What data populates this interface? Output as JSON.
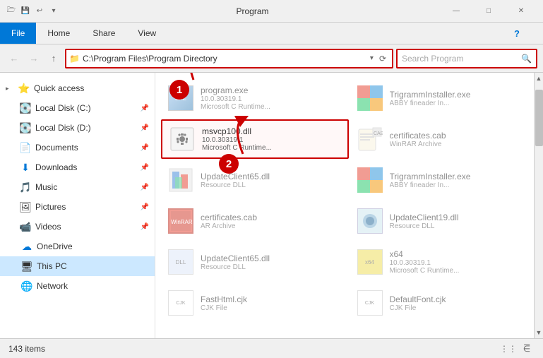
{
  "titleBar": {
    "title": "Program",
    "icons": [
      "folder-small",
      "save",
      "undo",
      "dropdown"
    ],
    "controls": [
      "minimize",
      "maximize",
      "close"
    ]
  },
  "ribbon": {
    "tabs": [
      "File",
      "Home",
      "Share",
      "View"
    ],
    "activeTab": "File",
    "helpIcon": "?"
  },
  "addressBar": {
    "backBtn": "←",
    "forwardBtn": "→",
    "upBtn": "↑",
    "path": "C:\\Program Files\\Program Directory",
    "dropdownIcon": "▾",
    "refreshIcon": "⟳",
    "searchPlaceholder": "Search Program",
    "searchIcon": "🔍"
  },
  "sidebar": {
    "items": [
      {
        "id": "quick-access",
        "label": "Quick access",
        "icon": "⭐",
        "hasArrow": true,
        "pinned": false
      },
      {
        "id": "local-disk-c",
        "label": "Local Disk (C:)",
        "icon": "💿",
        "hasArrow": false,
        "pinned": true
      },
      {
        "id": "local-disk-d",
        "label": "Local Disk (D:)",
        "icon": "💿",
        "hasArrow": false,
        "pinned": true
      },
      {
        "id": "documents",
        "label": "Documents",
        "icon": "📄",
        "hasArrow": false,
        "pinned": true
      },
      {
        "id": "downloads",
        "label": "Downloads",
        "icon": "⬇",
        "hasArrow": false,
        "pinned": true
      },
      {
        "id": "music",
        "label": "Music",
        "icon": "🎵",
        "hasArrow": false,
        "pinned": true
      },
      {
        "id": "pictures",
        "label": "Pictures",
        "icon": "🖼",
        "hasArrow": false,
        "pinned": true
      },
      {
        "id": "videos",
        "label": "Videos",
        "icon": "🎬",
        "hasArrow": false,
        "pinned": true
      },
      {
        "id": "onedrive",
        "label": "OneDrive",
        "icon": "☁",
        "hasArrow": false,
        "pinned": false
      },
      {
        "id": "this-pc",
        "label": "This PC",
        "icon": "🖥",
        "hasArrow": false,
        "pinned": false,
        "active": true
      },
      {
        "id": "network",
        "label": "Network",
        "icon": "🌐",
        "hasArrow": false,
        "pinned": false
      }
    ]
  },
  "fileList": {
    "items": [
      {
        "id": "program-exe",
        "name": "program.exe",
        "detail1": "10.0.30319.1",
        "detail2": "Microsoft C Runtime...",
        "iconType": "exe",
        "highlighted": false,
        "dimmed": true
      },
      {
        "id": "trigramminstaller-exe-1",
        "name": "TrigrammInstaller.exe",
        "detail1": "ABBY fineader In...",
        "detail2": "",
        "iconType": "colorful",
        "highlighted": false,
        "dimmed": true
      },
      {
        "id": "msvcp100-dll",
        "name": "msvcp100.dll",
        "detail1": "10.0.30319.1",
        "detail2": "Microsoft C Runtime...",
        "iconType": "gear",
        "highlighted": true,
        "dimmed": false
      },
      {
        "id": "certificates-cab",
        "name": "certificates.cab",
        "detail1": "WinRAR Archive",
        "detail2": "",
        "iconType": "cab",
        "highlighted": false,
        "dimmed": true
      },
      {
        "id": "updateclient65-dll-1",
        "name": "UpdateClient65.dll",
        "detail1": "Resource DLL",
        "detail2": "",
        "iconType": "colorful2",
        "highlighted": false,
        "dimmed": true
      },
      {
        "id": "trigramminstaller-exe-2",
        "name": "TrigrammInstaller.exe",
        "detail1": "ABBY fineader In...",
        "detail2": "",
        "iconType": "colorful",
        "highlighted": false,
        "dimmed": true
      },
      {
        "id": "certificates-cab-2",
        "name": "certificates.cab",
        "detail1": "AR Archive",
        "detail2": "",
        "iconType": "colorful3",
        "highlighted": false,
        "dimmed": true
      },
      {
        "id": "updateclient19-dll",
        "name": "UpdateClient19.dll",
        "detail1": "Resource DLL",
        "detail2": "",
        "iconType": "dll",
        "highlighted": false,
        "dimmed": true
      },
      {
        "id": "updateclient65-dll-2",
        "name": "UpdateClient65.dll",
        "detail1": "Resource DLL",
        "detail2": "",
        "iconType": "dll2",
        "highlighted": false,
        "dimmed": true
      },
      {
        "id": "x64",
        "name": "x64",
        "detail1": "10.0.30319.1",
        "detail2": "Microsoft C Runtime...",
        "iconType": "yellow",
        "highlighted": false,
        "dimmed": true
      },
      {
        "id": "fasthtml-cjk",
        "name": "FastHtml.cjk",
        "detail1": "CJK File",
        "detail2": "",
        "iconType": "white",
        "highlighted": false,
        "dimmed": true
      },
      {
        "id": "defaultfont-cjk",
        "name": "DefaultFont.cjk",
        "detail1": "CJK File",
        "detail2": "",
        "iconType": "white2",
        "highlighted": false,
        "dimmed": true
      }
    ]
  },
  "annotations": {
    "badge1": "1",
    "badge2": "2"
  },
  "statusBar": {
    "itemCount": "143 items"
  }
}
